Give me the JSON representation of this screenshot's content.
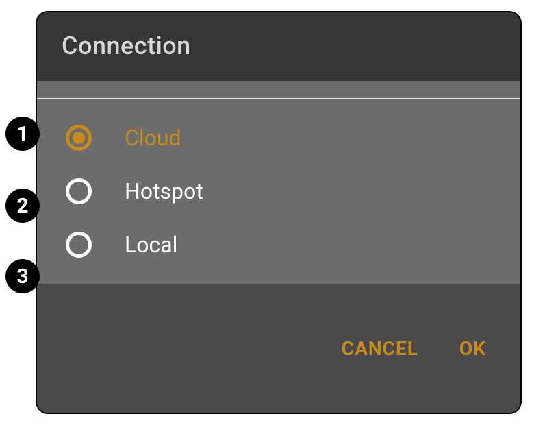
{
  "dialog": {
    "title": "Connection",
    "options": [
      {
        "label": "Cloud",
        "selected": true
      },
      {
        "label": "Hotspot",
        "selected": false
      },
      {
        "label": "Local",
        "selected": false
      }
    ],
    "cancel_label": "CANCEL",
    "ok_label": "OK"
  },
  "markers": [
    "1",
    "2",
    "3"
  ],
  "colors": {
    "accent": "#c68a1b",
    "dialog_bg": "#4a4a4a",
    "header_bg": "#363636",
    "panel_bg": "#6c6c6c"
  }
}
